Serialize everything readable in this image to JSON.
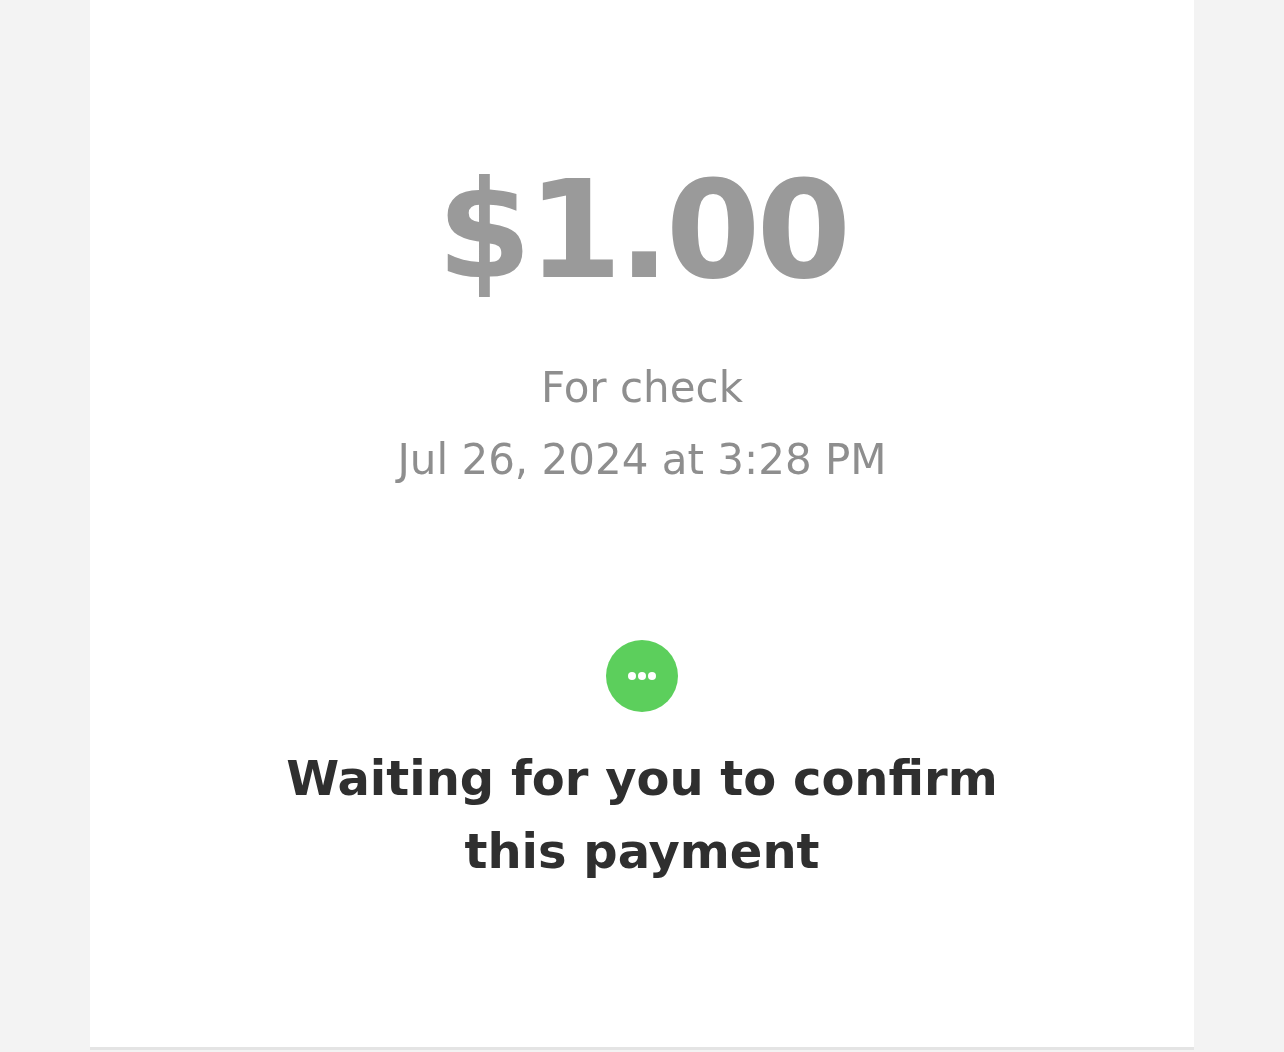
{
  "payment": {
    "amount": "$1.00",
    "note": "For check",
    "date": "Jul 26, 2024 at 3:28 PM"
  },
  "status": {
    "message": "Waiting for you to confirm this payment"
  }
}
